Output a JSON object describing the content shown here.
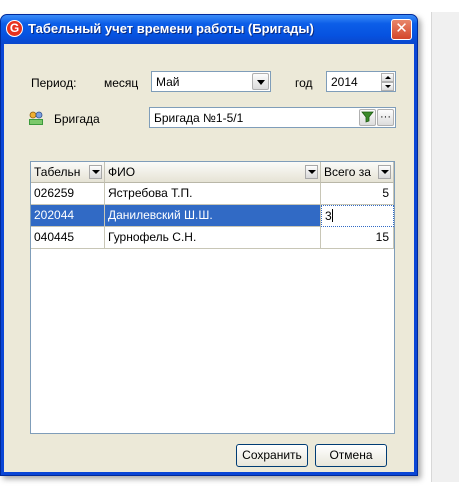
{
  "window": {
    "title": "Табельный учет времени работы (Бригады)",
    "close_glyph": "✕",
    "app_icon": "G"
  },
  "period": {
    "label": "Период:",
    "month_label": "месяц",
    "month_value": "Май",
    "year_label": "год",
    "year_value": "2014"
  },
  "brigade": {
    "label": "Бригада",
    "value": "Бригада №1-5/1",
    "more_button": "···"
  },
  "grid": {
    "columns": [
      "Табельн",
      "ФИО",
      "Всего за"
    ],
    "rows": [
      {
        "tab": "026259",
        "name": "Ястребова Т.П.",
        "total": "5"
      },
      {
        "tab": "202044",
        "name": "Данилевский Ш.Ш.",
        "total": "3"
      },
      {
        "tab": "040445",
        "name": "Гурнофель С.Н.",
        "total": "15"
      }
    ],
    "selected_row": 1
  },
  "buttons": {
    "save": "Сохранить",
    "cancel": "Отмена"
  },
  "colors": {
    "title_bar": "#0a5ee4",
    "selection": "#316ac5",
    "dialog_bg": "#ece9d8"
  }
}
